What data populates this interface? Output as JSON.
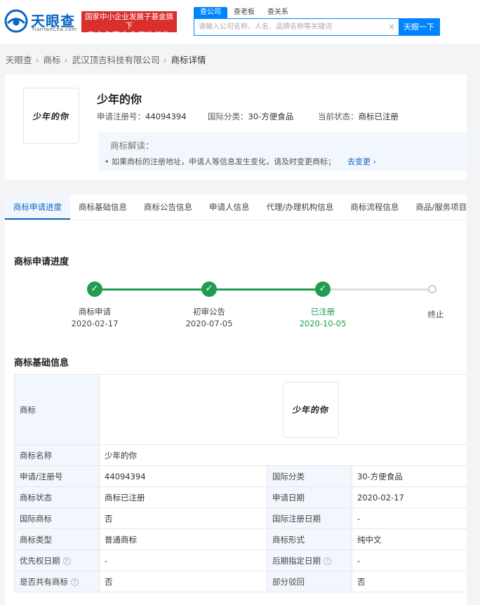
{
  "header": {
    "logo_name": "天眼查",
    "logo_domain": "TianYanCha.com",
    "slogan_line1": "国家中小企业发展子基金旗下",
    "slogan_line2": "官方备案企业征信机构",
    "search_tabs": [
      "查公司",
      "查老板",
      "查关系"
    ],
    "search_placeholder": "请输入公司名称、人名、品牌名称等关键词",
    "search_button": "天眼一下"
  },
  "breadcrumb": [
    "天眼查",
    "商标",
    "武汉顶吉科技有限公司",
    "商标详情"
  ],
  "summary": {
    "trademark_image_text": "少年的你",
    "title": "少年的你",
    "reg_no_label": "申请注册号：",
    "reg_no": "44094394",
    "class_label": "国际分类：",
    "class_value": "30-方便食品",
    "status_label": "当前状态：",
    "status_value": "商标已注册",
    "interp_title": "商标解读：",
    "interp_text": "• 如果商标的注册地址，申请人等信息发生变化，请及时变更商标；",
    "interp_link": "去变更 ›"
  },
  "tabs": [
    "商标申请进度",
    "商标基础信息",
    "商标公告信息",
    "申请人信息",
    "代理/办理机构信息",
    "商标流程信息",
    "商品/服务项目"
  ],
  "progress": {
    "title": "商标申请进度",
    "steps": [
      {
        "label": "商标申请",
        "date": "2020-02-17"
      },
      {
        "label": "初审公告",
        "date": "2020-07-05"
      },
      {
        "label": "已注册",
        "date": "2020-10-05"
      },
      {
        "label": "终止",
        "date": ""
      }
    ]
  },
  "basic": {
    "title": "商标基础信息",
    "image_label": "商标",
    "image_text": "少年的你",
    "name_label": "商标名称",
    "name_value": "少年的你",
    "rows": [
      {
        "k1": "申请/注册号",
        "v1": "44094394",
        "k2": "国际分类",
        "v2": "30-方便食品"
      },
      {
        "k1": "商标状态",
        "v1": "商标已注册",
        "k2": "申请日期",
        "v2": "2020-02-17"
      },
      {
        "k1": "国际商标",
        "v1": "否",
        "k2": "国际注册日期",
        "v2": "-"
      },
      {
        "k1": "商标类型",
        "v1": "普通商标",
        "k2": "商标形式",
        "v2": "纯中文"
      },
      {
        "k1": "优先权日期",
        "v1": "-",
        "k2": "后期指定日期",
        "v2": "-"
      },
      {
        "k1": "是否共有商标",
        "v1": "否",
        "k2": "部分驳回",
        "v2": "否"
      }
    ]
  },
  "colors": {
    "brand": "#0a66c2",
    "accent": "#0084ff",
    "success": "#1f9e52",
    "slogan": "#d9302d"
  },
  "icons": {
    "clear": "close-icon",
    "check": "check-icon",
    "help": "question-icon"
  }
}
